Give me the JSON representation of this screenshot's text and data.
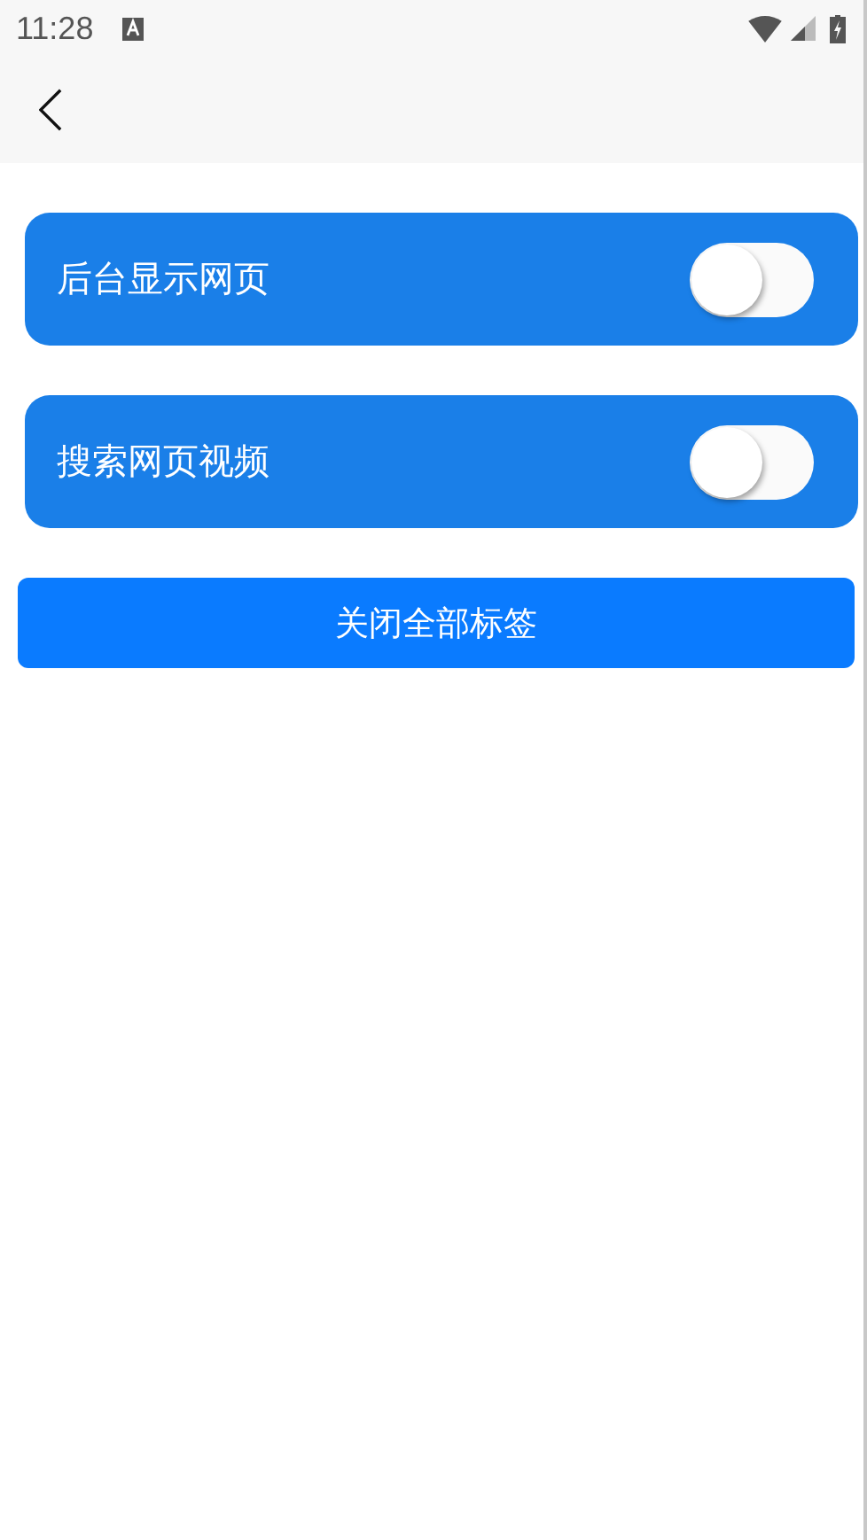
{
  "status_bar": {
    "time": "11:28"
  },
  "settings": [
    {
      "label": "后台显示网页",
      "on": false
    },
    {
      "label": "搜索网页视频",
      "on": false
    }
  ],
  "close_button": {
    "label": "关闭全部标签"
  }
}
